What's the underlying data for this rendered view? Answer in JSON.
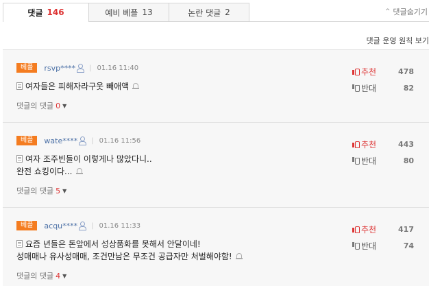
{
  "tabs": [
    {
      "label": "댓글",
      "count": "146"
    },
    {
      "label": "예비 베플",
      "count": "13"
    },
    {
      "label": "논란 댓글",
      "count": "2"
    }
  ],
  "hide_comments": "댓글숨기기",
  "rules_link": "댓글 운영 원칙 보기",
  "replies_label": "댓글의 댓글",
  "vote_up_label": "추천",
  "vote_down_label": "반대",
  "comments": [
    {
      "badge": "베플",
      "user": "rsvp****",
      "time": "01.16 11:40",
      "lines": [
        "여자들은 피해자라구웃 빼애액"
      ],
      "up": "478",
      "down": "82",
      "replies": "0"
    },
    {
      "badge": "베플",
      "user": "wate****",
      "time": "01.16 11:56",
      "lines": [
        "여자 조주빈들이 이렇게나 많았다니..",
        "완전 쇼킹이다..."
      ],
      "up": "443",
      "down": "80",
      "replies": "5"
    },
    {
      "badge": "베플",
      "user": "acqu****",
      "time": "01.16 11:33",
      "lines": [
        "요즘 년들은 돈앞에서 성상품화를 못해서 안달이네!",
        "성매매나 유사성매매, 조건만남은 무조건 공급자만 처벌해야함!"
      ],
      "up": "417",
      "down": "74",
      "replies": "4"
    }
  ],
  "colors": {
    "accent": "#dd3333",
    "badge": "#f47c20",
    "user": "#4a6fa5"
  }
}
